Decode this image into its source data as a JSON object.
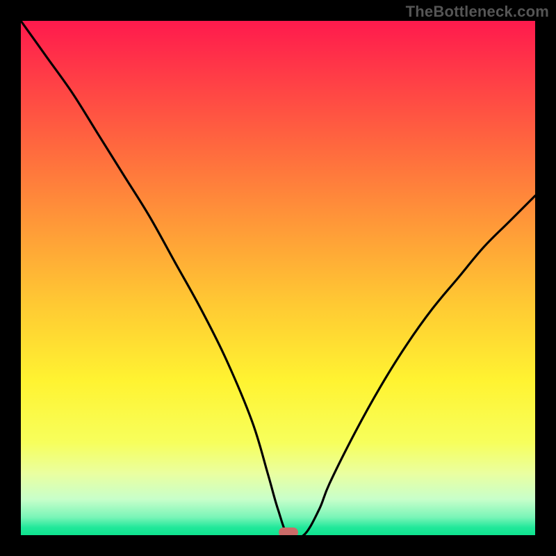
{
  "watermark": "TheBottleneck.com",
  "chart_data": {
    "type": "line",
    "title": "",
    "xlabel": "",
    "ylabel": "",
    "xlim": [
      0,
      100
    ],
    "ylim": [
      0,
      100
    ],
    "grid": false,
    "legend": false,
    "series": [
      {
        "name": "bottleneck-curve",
        "x": [
          0,
          5,
          10,
          15,
          20,
          25,
          30,
          35,
          40,
          45,
          48,
          50,
          52,
          55,
          58,
          60,
          65,
          70,
          75,
          80,
          85,
          90,
          95,
          100
        ],
        "values": [
          100,
          93,
          86,
          78,
          70,
          62,
          53,
          44,
          34,
          22,
          12,
          5,
          0,
          0,
          5,
          10,
          20,
          29,
          37,
          44,
          50,
          56,
          61,
          66
        ]
      }
    ],
    "marker": {
      "x": 52,
      "y": 0,
      "color": "#cb6b68"
    },
    "background_gradient": {
      "stops": [
        {
          "offset": 0,
          "color": "#ff1a4d"
        },
        {
          "offset": 0.1,
          "color": "#ff3a47"
        },
        {
          "offset": 0.25,
          "color": "#ff6a3e"
        },
        {
          "offset": 0.4,
          "color": "#ff9a38"
        },
        {
          "offset": 0.55,
          "color": "#ffc933"
        },
        {
          "offset": 0.7,
          "color": "#fff331"
        },
        {
          "offset": 0.82,
          "color": "#f7ff5c"
        },
        {
          "offset": 0.88,
          "color": "#eaffa0"
        },
        {
          "offset": 0.93,
          "color": "#c8ffca"
        },
        {
          "offset": 0.965,
          "color": "#7af5b8"
        },
        {
          "offset": 0.985,
          "color": "#21e89a"
        },
        {
          "offset": 1.0,
          "color": "#0ee38f"
        }
      ]
    }
  }
}
